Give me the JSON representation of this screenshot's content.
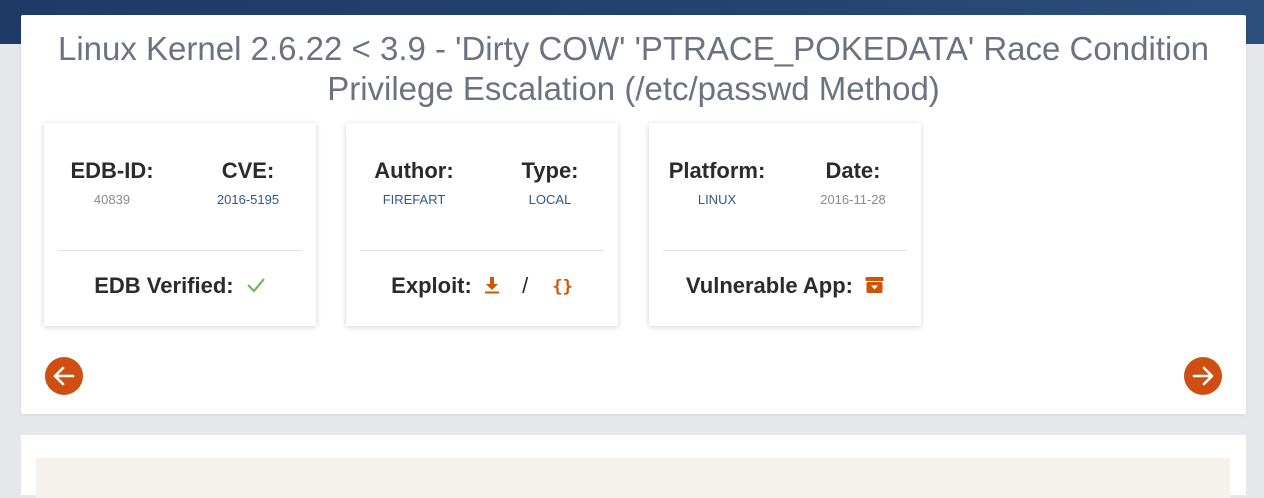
{
  "title": "Linux Kernel 2.6.22 < 3.9 - 'Dirty COW' 'PTRACE_POKEDATA' Race Condition Privilege Escalation (/etc/passwd Method)",
  "card1": {
    "edb_id_label": "EDB-ID:",
    "edb_id_value": "40839",
    "cve_label": "CVE:",
    "cve_value": "2016-5195",
    "verified_label": "EDB Verified:",
    "verified_icon": "check-icon"
  },
  "card2": {
    "author_label": "Author:",
    "author_value": "FIREFART",
    "type_label": "Type:",
    "type_value": "LOCAL",
    "exploit_label": "Exploit:",
    "separator": "/",
    "download_icon": "download-icon",
    "braces_icon": "code-braces-icon",
    "braces_text": "{}"
  },
  "card3": {
    "platform_label": "Platform:",
    "platform_value": "LINUX",
    "date_label": "Date:",
    "date_value": "2016-11-28",
    "vuln_app_label": "Vulnerable App:",
    "archive_icon": "archive-icon"
  },
  "nav": {
    "prev_icon": "arrow-left-icon",
    "next_icon": "arrow-right-icon"
  },
  "colors": {
    "accent": "#cf4f12",
    "link": "#2e5a8a",
    "check": "#7ab55c",
    "header": "#1f3a66"
  }
}
